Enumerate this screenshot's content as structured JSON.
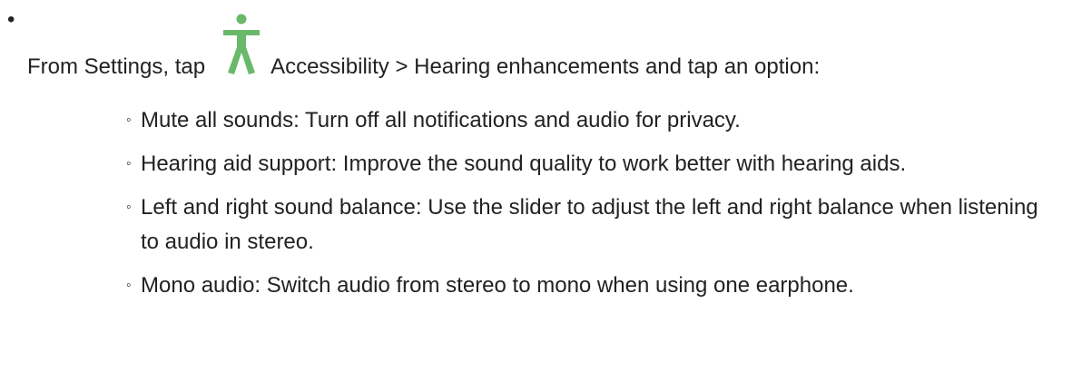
{
  "intro": {
    "before_icon": "From Settings, tap",
    "after_icon": "Accessibility > Hearing enhancements and tap an option:",
    "icon": "accessibility-person-icon",
    "icon_color": "#6ab86a"
  },
  "options": [
    {
      "text": "Mute all sounds: Turn off all notifications and audio for privacy."
    },
    {
      "text": "Hearing aid support: Improve the sound quality to work better with hearing aids."
    },
    {
      "text": "Left and right sound balance: Use the slider to adjust the left and right balance when listening to audio in stereo."
    },
    {
      "text": "Mono audio: Switch audio from stereo to mono when using one earphone."
    }
  ]
}
